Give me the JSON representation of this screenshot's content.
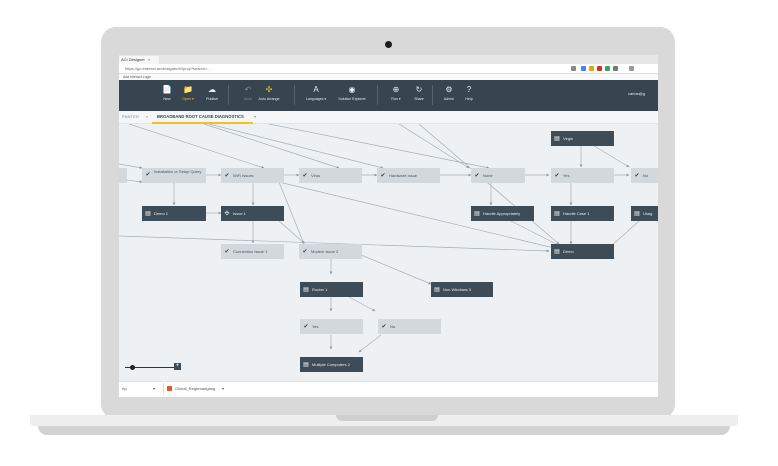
{
  "browser": {
    "tab_title": "ACI Designer",
    "tab_close": "×",
    "url": "https://go.interact.ac/designer/#!/proj/?search=...",
    "bookmark": "Add interact Login"
  },
  "toolbar": {
    "logo": "",
    "buttons": [
      {
        "label": "New",
        "icon": "📄"
      },
      {
        "label": "Open ▾",
        "icon": "📁"
      },
      {
        "label": "Publish",
        "icon": "☁"
      },
      {
        "label": "Undo",
        "icon": "↶"
      },
      {
        "label": "Auto Arrange",
        "icon": "✣"
      },
      {
        "label": "Languages ▾",
        "icon": "A"
      },
      {
        "label": "Solution Explorer",
        "icon": "◉"
      },
      {
        "label": "Run ▾",
        "icon": "⊕"
      },
      {
        "label": "Share",
        "icon": "↻"
      },
      {
        "label": "Admin",
        "icon": "⚙"
      },
      {
        "label": "Help",
        "icon": "?"
      }
    ],
    "user": "carlos@g"
  },
  "breadcrumb": {
    "previous": "PANTED",
    "separator": "»",
    "current": "BROADBAND ROOT CAUSE DIAGNOSTICS",
    "caret": "▾"
  },
  "flow": {
    "nodes": [
      {
        "id": "install",
        "label": "Installation or Setup Query",
        "kind": "check"
      },
      {
        "id": "wifi",
        "label": "WiFi Issues",
        "kind": "check"
      },
      {
        "id": "virus",
        "label": "Virus",
        "kind": "check"
      },
      {
        "id": "hardware",
        "label": "Hardware Issue",
        "kind": "check"
      },
      {
        "id": "virgin",
        "label": "Virgin",
        "kind": "doc"
      },
      {
        "id": "none",
        "label": "None",
        "kind": "check"
      },
      {
        "id": "yes-top",
        "label": "Yes",
        "kind": "check"
      },
      {
        "id": "no-top",
        "label": "No",
        "kind": "check"
      },
      {
        "id": "demo1",
        "label": "Demo 1",
        "kind": "doc"
      },
      {
        "id": "issue",
        "label": "Issue 1",
        "kind": "gear"
      },
      {
        "id": "handle-appropriately",
        "label": "Handle Appropriately",
        "kind": "doc"
      },
      {
        "id": "handle-case",
        "label": "Handle Case 1",
        "kind": "doc"
      },
      {
        "id": "right-cut",
        "label": "Usag",
        "kind": "doc"
      },
      {
        "id": "connection",
        "label": "Connection Issue 1",
        "kind": "check"
      },
      {
        "id": "modem",
        "label": "Modem Issue 2",
        "kind": "check"
      },
      {
        "id": "demo",
        "label": "Demo",
        "kind": "doc"
      },
      {
        "id": "router",
        "label": "Router 1",
        "kind": "doc"
      },
      {
        "id": "non-windows",
        "label": "Non Windows 3",
        "kind": "doc"
      },
      {
        "id": "yes-bottom",
        "label": "Yes",
        "kind": "check"
      },
      {
        "id": "no-bottom",
        "label": "No",
        "kind": "check"
      },
      {
        "id": "multiple",
        "label": "Multiple Computers 2",
        "kind": "doc"
      }
    ]
  },
  "zoom": {
    "level": 0.15,
    "plus": "+"
  },
  "statusbar": {
    "left": "rtp",
    "left_caret": "▾",
    "download": "Global_Regbroadgang",
    "download_caret": "▾"
  },
  "colors": {
    "toolbar": "#364550",
    "node_dark": "#3e4c57",
    "node_light": "#d3d8dc",
    "accent": "#f5c11e"
  }
}
